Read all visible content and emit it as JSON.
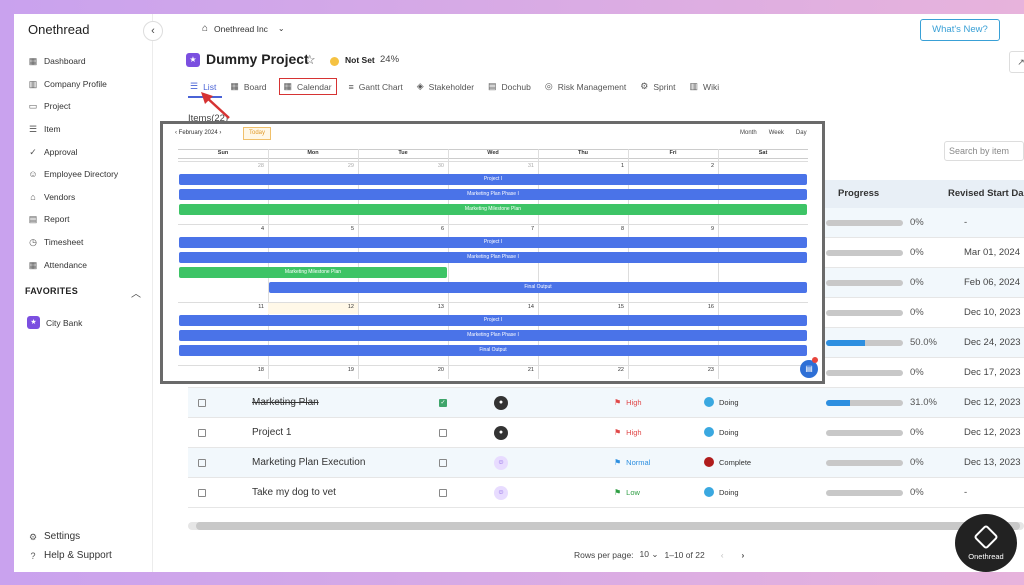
{
  "app": {
    "brand": "Onethread",
    "brand_badge": "Onethread"
  },
  "sidebar": {
    "items": [
      {
        "label": "Dashboard",
        "icon": "grid-icon"
      },
      {
        "label": "Company Profile",
        "icon": "building-icon"
      },
      {
        "label": "Project",
        "icon": "folder-icon"
      },
      {
        "label": "Item",
        "icon": "list-icon"
      },
      {
        "label": "Approval",
        "icon": "check-icon"
      },
      {
        "label": "Employee Directory",
        "icon": "users-icon"
      },
      {
        "label": "Vendors",
        "icon": "store-icon"
      },
      {
        "label": "Report",
        "icon": "report-icon"
      },
      {
        "label": "Timesheet",
        "icon": "clock-icon"
      },
      {
        "label": "Attendance",
        "icon": "calendar-icon"
      }
    ],
    "favorites_title": "FAVORITES",
    "favorites": [
      {
        "label": "City Bank"
      }
    ],
    "bottom": [
      {
        "label": "Settings",
        "icon": "gear-icon"
      },
      {
        "label": "Help & Support",
        "icon": "help-icon"
      }
    ]
  },
  "header": {
    "org": "Onethread Inc",
    "whats_new": "What's New?"
  },
  "project": {
    "title": "Dummy Project",
    "status": "Not Set",
    "progress": "24%",
    "status_color": "#f5c242"
  },
  "tabs": [
    {
      "label": "List",
      "icon": "list-icon"
    },
    {
      "label": "Board",
      "icon": "board-icon"
    },
    {
      "label": "Calendar",
      "icon": "calendar-icon"
    },
    {
      "label": "Gantt Chart",
      "icon": "gantt-icon"
    },
    {
      "label": "Stakeholder",
      "icon": "stakeholder-icon"
    },
    {
      "label": "Dochub",
      "icon": "doc-icon"
    },
    {
      "label": "Risk Management",
      "icon": "risk-icon"
    },
    {
      "label": "Sprint",
      "icon": "sprint-icon"
    },
    {
      "label": "Wiki",
      "icon": "wiki-icon"
    }
  ],
  "items_label": "Items(22)",
  "search_placeholder": "Search by item",
  "table": {
    "col_progress": "Progress",
    "col_revised": "Revised Start Da",
    "top_rows": [
      {
        "pct": "0%",
        "progress": 0,
        "date": "-"
      },
      {
        "pct": "0%",
        "progress": 0,
        "date": "Mar 01, 2024"
      },
      {
        "pct": "0%",
        "progress": 0,
        "date": "Feb 06, 2024"
      },
      {
        "pct": "0%",
        "progress": 0,
        "date": "Dec 10, 2023"
      },
      {
        "pct": "50.0%",
        "progress": 0.5,
        "date": "Dec 24, 2023"
      },
      {
        "pct": "0%",
        "progress": 0,
        "date": "Dec 17, 2023"
      }
    ],
    "rows": [
      {
        "name": "Marketing Plan",
        "strike": true,
        "checked": true,
        "avatar": "photo",
        "priority": "High",
        "priority_color": "#e04848",
        "status": "Doing",
        "status_color": "#3aa8e0",
        "pct": "31.0%",
        "progress": 0.31,
        "date": "Dec 12, 2023"
      },
      {
        "name": "Project 1",
        "strike": false,
        "checked": false,
        "avatar": "photo",
        "priority": "High",
        "priority_color": "#e04848",
        "status": "Doing",
        "status_color": "#3aa8e0",
        "pct": "0%",
        "progress": 0,
        "date": "Dec 12, 2023"
      },
      {
        "name": "Marketing Plan Execution",
        "strike": false,
        "checked": false,
        "avatar": "generic",
        "priority": "Normal",
        "priority_color": "#2d8fe0",
        "status": "Complete",
        "status_color": "#b01c1c",
        "pct": "0%",
        "progress": 0,
        "date": "Dec 13, 2023"
      },
      {
        "name": "Take my dog to vet",
        "strike": false,
        "checked": false,
        "avatar": "generic",
        "priority": "Low",
        "priority_color": "#2f9e44",
        "status": "Doing",
        "status_color": "#3aa8e0",
        "pct": "0%",
        "progress": 0,
        "date": "-"
      }
    ]
  },
  "pagination": {
    "rows_per_page_label": "Rows per page:",
    "rows_per_page": "10",
    "range": "1–10 of 22"
  },
  "calendar": {
    "month": "February 2024",
    "today": "Today",
    "views": [
      "Month",
      "Week",
      "Day"
    ],
    "days": [
      "Sun",
      "Mon",
      "Tue",
      "Wed",
      "Thu",
      "Fri",
      "Sat"
    ],
    "weeks": [
      [
        "28",
        "29",
        "30",
        "31",
        "1",
        "2",
        ""
      ],
      [
        "4",
        "5",
        "6",
        "7",
        "8",
        "9",
        ""
      ],
      [
        "11",
        "12",
        "13",
        "14",
        "15",
        "16",
        ""
      ],
      [
        "18",
        "19",
        "20",
        "21",
        "22",
        "23",
        ""
      ]
    ],
    "events": [
      {
        "label": "Project I",
        "week": 0,
        "slot": 0,
        "start": 0,
        "span": 7,
        "color": "#4a73e8"
      },
      {
        "label": "Marketing Plan Phase I",
        "week": 0,
        "slot": 1,
        "start": 0,
        "span": 7,
        "color": "#4a73e8"
      },
      {
        "label": "Marketing Milestone Plan",
        "week": 0,
        "slot": 2,
        "start": 0,
        "span": 7,
        "color": "#3dc466"
      },
      {
        "label": "Project I",
        "week": 1,
        "slot": 0,
        "start": 0,
        "span": 7,
        "color": "#4a73e8"
      },
      {
        "label": "Marketing Plan Phase I",
        "week": 1,
        "slot": 1,
        "start": 0,
        "span": 7,
        "color": "#4a73e8"
      },
      {
        "label": "Marketing Milestone Plan",
        "week": 1,
        "slot": 2,
        "start": 0,
        "span": 3,
        "color": "#3dc466"
      },
      {
        "label": "Final Output",
        "week": 1,
        "slot": 3,
        "start": 1,
        "span": 6,
        "color": "#4a73e8"
      },
      {
        "label": "Project I",
        "week": 2,
        "slot": 0,
        "start": 0,
        "span": 7,
        "color": "#4a73e8"
      },
      {
        "label": "Marketing Plan Phase I",
        "week": 2,
        "slot": 1,
        "start": 0,
        "span": 7,
        "color": "#4a73e8"
      },
      {
        "label": "Final Output",
        "week": 2,
        "slot": 2,
        "start": 0,
        "span": 7,
        "color": "#4a73e8"
      }
    ]
  }
}
